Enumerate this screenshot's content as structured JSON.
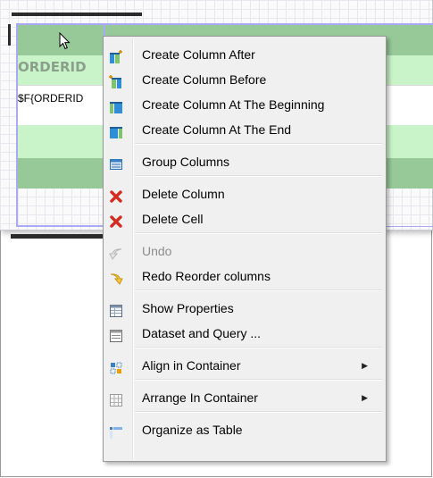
{
  "table": {
    "header_cell_text": "ORDERID",
    "field_cell_text": "$F{ORDERID"
  },
  "colors": {
    "band_dark": "#97c998",
    "band_light": "#c9f3c9",
    "selection": "#a9a9f5",
    "menu_bg": "#f0f0f0"
  },
  "context_menu": {
    "items": [
      {
        "label": "Create Column After",
        "icon": "column-add-after-icon"
      },
      {
        "label": "Create Column Before",
        "icon": "column-add-before-icon"
      },
      {
        "label": "Create Column At The Beginning",
        "icon": "column-add-beginning-icon"
      },
      {
        "label": "Create Column At The End",
        "icon": "column-add-end-icon"
      },
      {
        "label": "Group Columns",
        "icon": "group-columns-icon"
      },
      {
        "label": "Delete Column",
        "icon": "delete-x-icon"
      },
      {
        "label": "Delete Cell",
        "icon": "delete-x-icon"
      },
      {
        "label": "Undo",
        "icon": "undo-arrow-icon",
        "enabled": false
      },
      {
        "label": "Redo Reorder columns",
        "icon": "redo-arrow-icon"
      },
      {
        "label": "Show Properties",
        "icon": "properties-table-icon"
      },
      {
        "label": "Dataset and Query ...",
        "icon": "dataset-icon"
      },
      {
        "label": "Align in Container",
        "icon": "align-container-icon",
        "submenu": true
      },
      {
        "label": "Arrange In Container",
        "icon": "arrange-grid-icon",
        "submenu": true
      },
      {
        "label": "Organize as Table",
        "icon": "organize-table-icon"
      }
    ]
  }
}
